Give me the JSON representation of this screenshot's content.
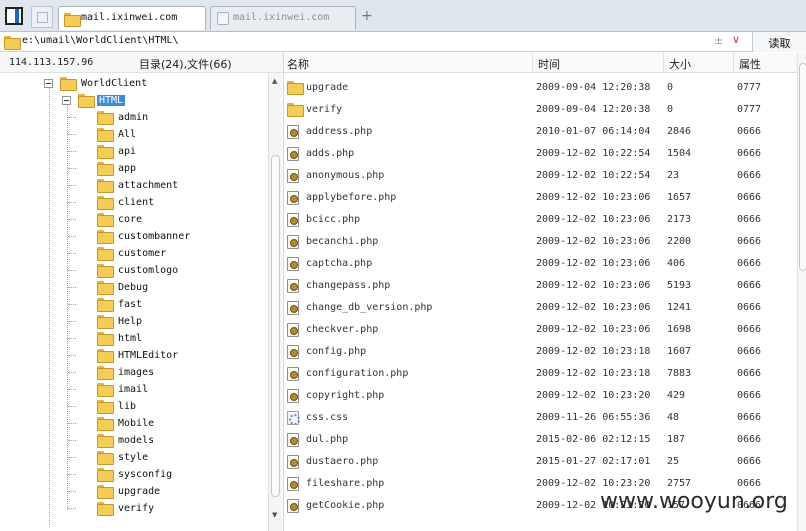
{
  "tabs": [
    {
      "label": "mail.ixinwei.com",
      "active": true
    },
    {
      "label": "mail.ixinwei.com",
      "active": false
    }
  ],
  "add_tab_label": "+",
  "address": {
    "path": "e:\\umail\\WorldClient\\HTML\\",
    "fav_glyph": "±",
    "dropdown_glyph": "∨",
    "read_button": "读取"
  },
  "info": {
    "ip": "114.113.157.96",
    "counts": "目录(24),文件(66)"
  },
  "tree": {
    "root": "WorldClient",
    "selected": "HTML",
    "children": [
      "admin",
      "All",
      "api",
      "app",
      "attachment",
      "client",
      "core",
      "custombanner",
      "customer",
      "customlogo",
      "Debug",
      "fast",
      "Help",
      "html",
      "HTMLEditor",
      "images",
      "imail",
      "lib",
      "Mobile",
      "models",
      "style",
      "sysconfig",
      "upgrade",
      "verify"
    ]
  },
  "list": {
    "headers": {
      "name": "名称",
      "time": "时间",
      "size": "大小",
      "attr": "属性"
    },
    "rows": [
      {
        "type": "folder",
        "name": "upgrade",
        "time": "2009-09-04 12:20:38",
        "size": "0",
        "attr": "0777"
      },
      {
        "type": "folder",
        "name": "verify",
        "time": "2009-09-04 12:20:38",
        "size": "0",
        "attr": "0777"
      },
      {
        "type": "php",
        "name": "address.php",
        "time": "2010-01-07 06:14:04",
        "size": "2846",
        "attr": "0666"
      },
      {
        "type": "php",
        "name": "adds.php",
        "time": "2009-12-02 10:22:54",
        "size": "1504",
        "attr": "0666"
      },
      {
        "type": "php",
        "name": "anonymous.php",
        "time": "2009-12-02 10:22:54",
        "size": "23",
        "attr": "0666"
      },
      {
        "type": "php",
        "name": "applybefore.php",
        "time": "2009-12-02 10:23:06",
        "size": "1657",
        "attr": "0666"
      },
      {
        "type": "php",
        "name": "bcicc.php",
        "time": "2009-12-02 10:23:06",
        "size": "2173",
        "attr": "0666"
      },
      {
        "type": "php",
        "name": "becanchi.php",
        "time": "2009-12-02 10:23:06",
        "size": "2200",
        "attr": "0666"
      },
      {
        "type": "php",
        "name": "captcha.php",
        "time": "2009-12-02 10:23:06",
        "size": "406",
        "attr": "0666"
      },
      {
        "type": "php",
        "name": "changepass.php",
        "time": "2009-12-02 10:23:06",
        "size": "5193",
        "attr": "0666"
      },
      {
        "type": "php",
        "name": "change_db_version.php",
        "time": "2009-12-02 10:23:06",
        "size": "1241",
        "attr": "0666"
      },
      {
        "type": "php",
        "name": "checkver.php",
        "time": "2009-12-02 10:23:06",
        "size": "1698",
        "attr": "0666"
      },
      {
        "type": "php",
        "name": "config.php",
        "time": "2009-12-02 10:23:18",
        "size": "1607",
        "attr": "0666"
      },
      {
        "type": "php",
        "name": "configuration.php",
        "time": "2009-12-02 10:23:18",
        "size": "7883",
        "attr": "0666"
      },
      {
        "type": "php",
        "name": "copyright.php",
        "time": "2009-12-02 10:23:20",
        "size": "429",
        "attr": "0666"
      },
      {
        "type": "css",
        "name": "css.css",
        "time": "2009-11-26 06:55:36",
        "size": "48",
        "attr": "0666"
      },
      {
        "type": "php",
        "name": "dul.php",
        "time": "2015-02-06 02:12:15",
        "size": "187",
        "attr": "0666"
      },
      {
        "type": "php",
        "name": "dustaero.php",
        "time": "2015-01-27 02:17:01",
        "size": "25",
        "attr": "0666"
      },
      {
        "type": "php",
        "name": "fileshare.php",
        "time": "2009-12-02 10:23:20",
        "size": "2757",
        "attr": "0666"
      },
      {
        "type": "php",
        "name": "getCookie.php",
        "time": "2009-12-02 10:23:20",
        "size": "157",
        "attr": "0666"
      }
    ]
  },
  "watermark": "www.wooyun.org"
}
